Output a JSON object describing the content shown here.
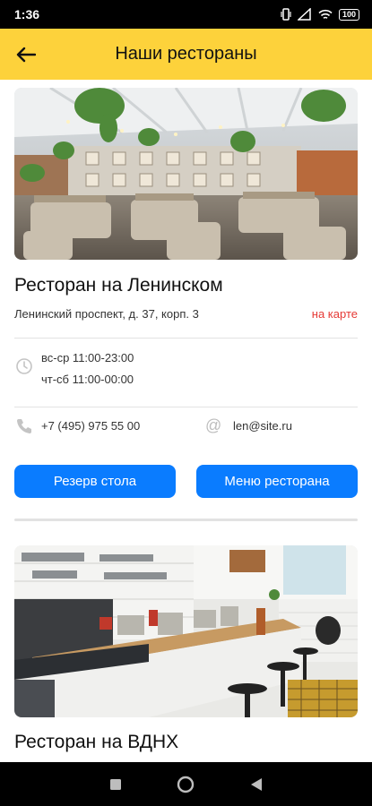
{
  "status_bar": {
    "time": "1:36",
    "battery": "100"
  },
  "header": {
    "title": "Наши рестораны"
  },
  "restaurants": [
    {
      "name": "Ресторан на Ленинском",
      "address": "Ленинский проспект, д. 37, корп. 3",
      "map_link": "на карте",
      "hours": [
        "вс-ср 11:00-23:00",
        "чт-сб 11:00-00:00"
      ],
      "phone": "+7 (495) 975 55 00",
      "email": "len@site.ru",
      "reserve_label": "Резерв стола",
      "menu_label": "Меню ресторана"
    },
    {
      "name": "Ресторан на ВДНХ"
    }
  ],
  "colors": {
    "accent_yellow": "#fdd23b",
    "button_blue": "#0a7cff",
    "link_red": "#e53935"
  },
  "icons": [
    "back-arrow-icon",
    "clock-icon",
    "phone-icon",
    "at-icon",
    "square-icon",
    "circle-icon",
    "triangle-icon"
  ]
}
